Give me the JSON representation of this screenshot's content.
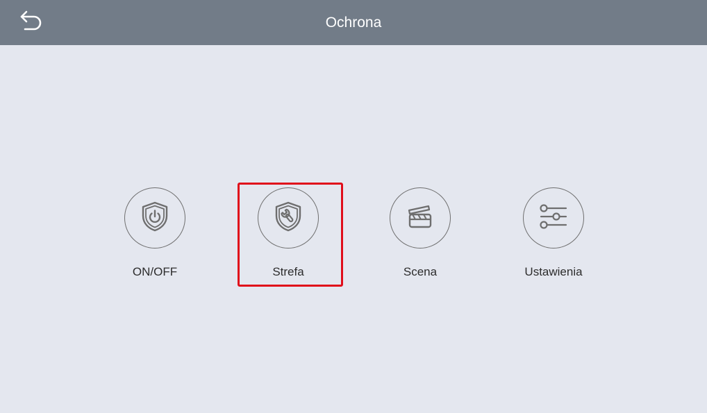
{
  "header": {
    "title": "Ochrona",
    "back_icon": "back-arrow-icon"
  },
  "menu": {
    "items": [
      {
        "label": "ON/OFF",
        "icon": "shield-power-icon"
      },
      {
        "label": "Strefa",
        "icon": "shield-wrench-icon"
      },
      {
        "label": "Scena",
        "icon": "clapperboard-icon"
      },
      {
        "label": "Ustawienia",
        "icon": "sliders-icon"
      }
    ],
    "selected_index": 1
  },
  "colors": {
    "header_bg": "#727c88",
    "page_bg": "#e4e7ef",
    "icon_stroke": "#6e6e6e",
    "highlight": "#e00d1a"
  }
}
